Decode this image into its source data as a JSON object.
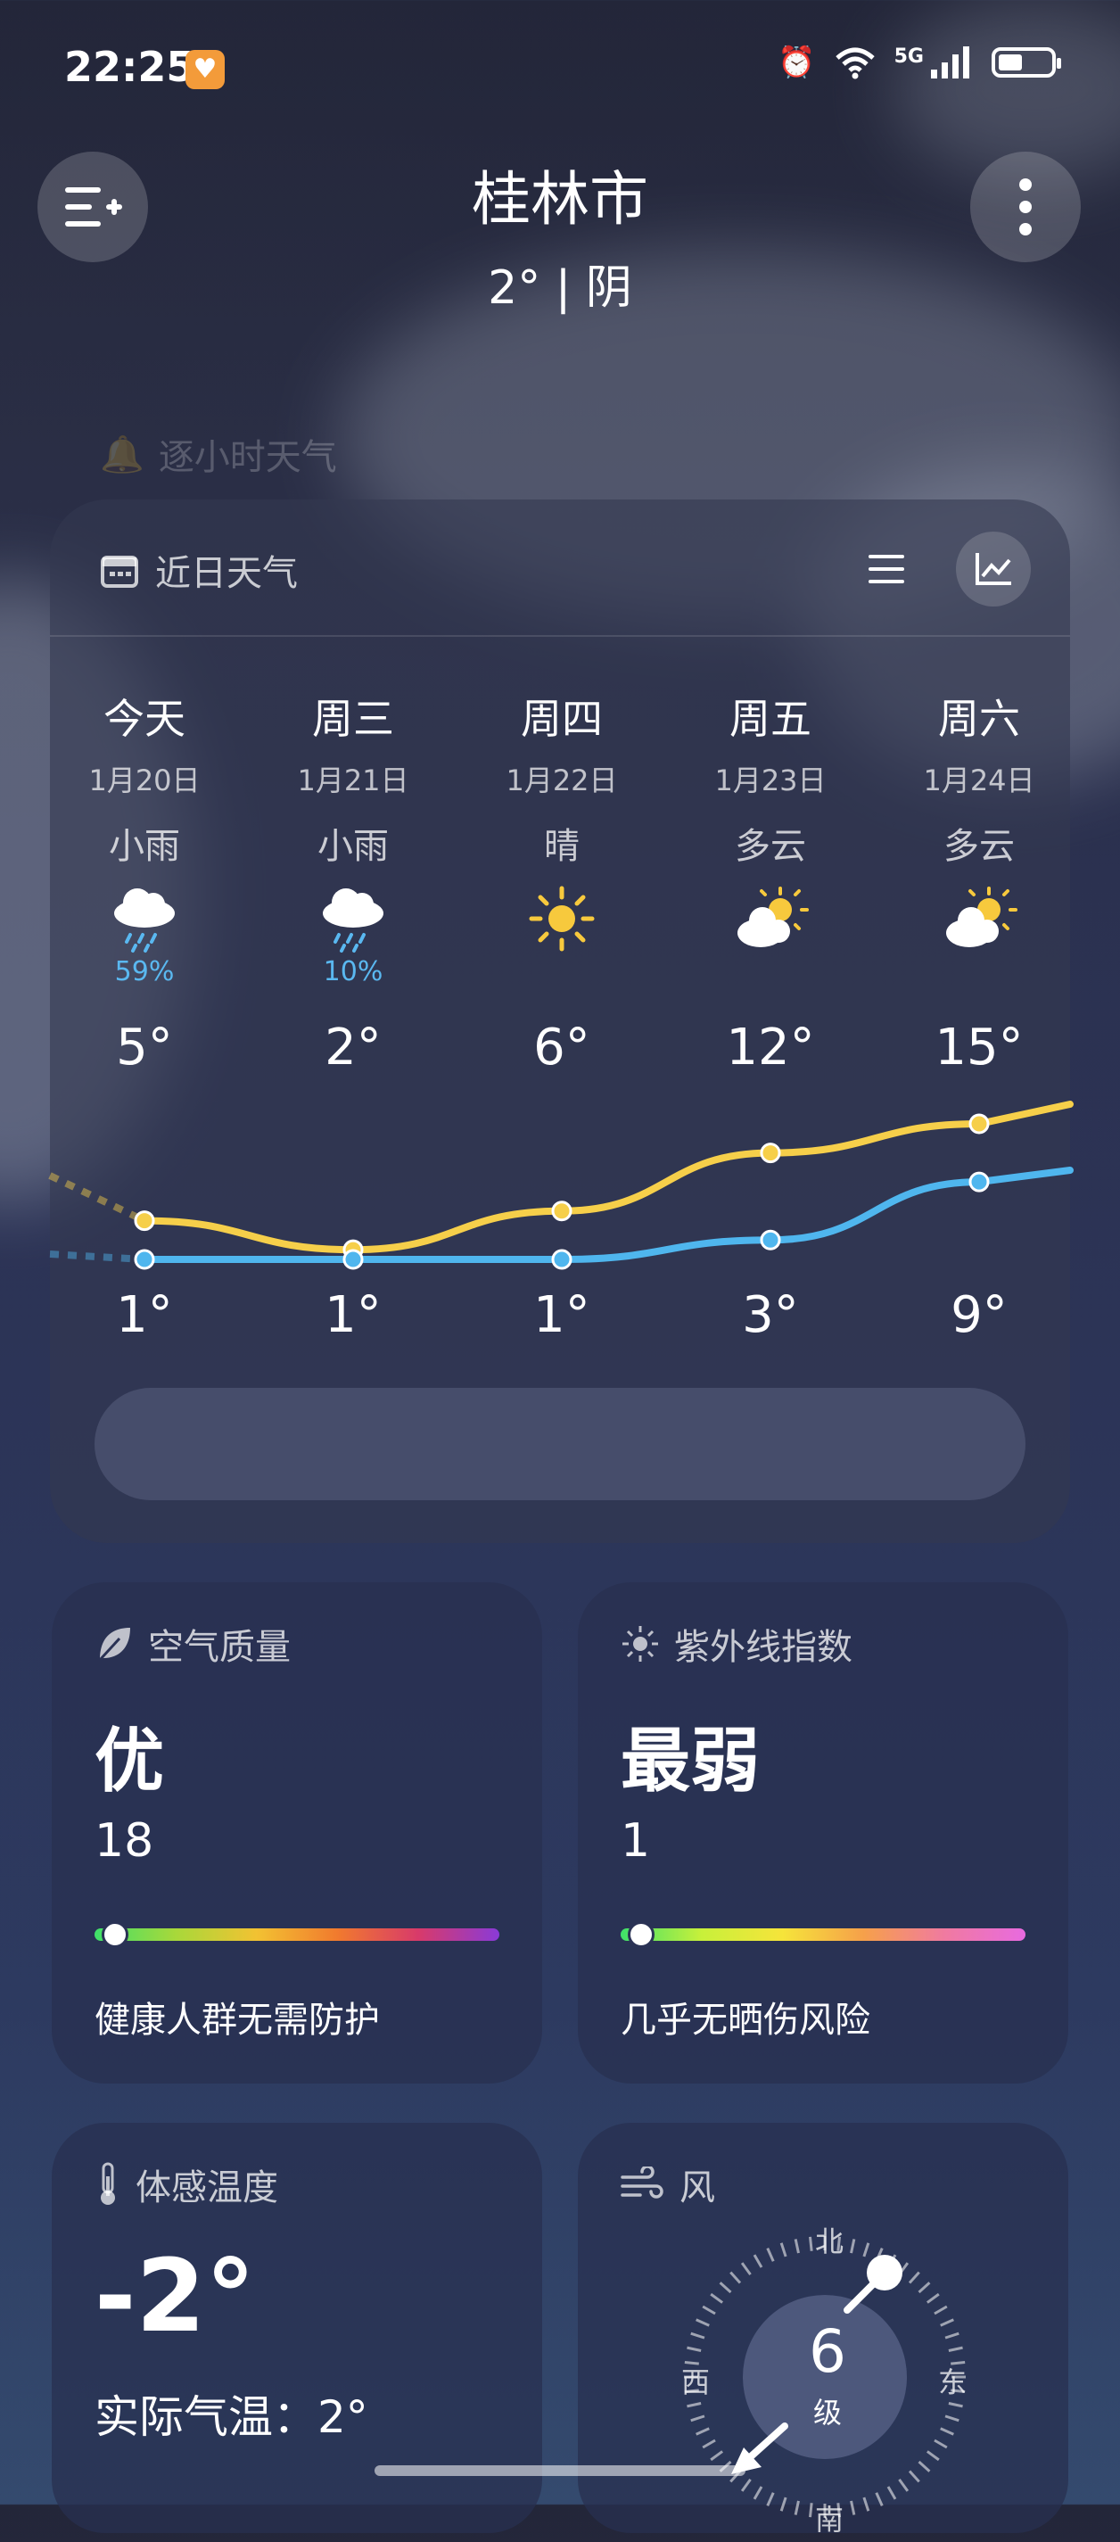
{
  "status": {
    "time": "22:25",
    "network": "5G"
  },
  "header": {
    "city": "桂林市",
    "current": "2° | 阴"
  },
  "hourly_label": "逐小时天气",
  "forecast": {
    "title": "近日天气",
    "days": [
      {
        "name": "今天",
        "date": "1月20日",
        "weather": "小雨",
        "icon": "rain-cloud-icon",
        "precip": "59%",
        "high": "5°",
        "low": "1°"
      },
      {
        "name": "周三",
        "date": "1月21日",
        "weather": "小雨",
        "icon": "rain-cloud-icon",
        "precip": "10%",
        "high": "2°",
        "low": "1°"
      },
      {
        "name": "周四",
        "date": "1月22日",
        "weather": "晴",
        "icon": "sun-icon",
        "precip": "",
        "high": "6°",
        "low": "1°"
      },
      {
        "name": "周五",
        "date": "1月23日",
        "weather": "多云",
        "icon": "partly-cloudy-icon",
        "precip": "",
        "high": "12°",
        "low": "3°"
      },
      {
        "name": "周六",
        "date": "1月24日",
        "weather": "多云",
        "icon": "partly-cloudy-icon",
        "precip": "",
        "high": "15°",
        "low": "9°"
      }
    ],
    "pill_text": "",
    "colors": {
      "high_line": "#f6cf4a",
      "low_line": "#4fb6ee"
    }
  },
  "air": {
    "title": "空气质量",
    "level": "优",
    "value": "18",
    "note": "健康人群无需防护",
    "fraction": 0.05
  },
  "uv": {
    "title": "紫外线指数",
    "level": "最弱",
    "value": "1",
    "note": "几乎无晒伤风险",
    "fraction": 0.05
  },
  "feel": {
    "title": "体感温度",
    "value": "-2°",
    "actual": "实际气温：2°"
  },
  "wind": {
    "title": "风",
    "level": "6",
    "unit": "级",
    "n": "北",
    "s": "南",
    "e": "东",
    "w": "西"
  }
}
